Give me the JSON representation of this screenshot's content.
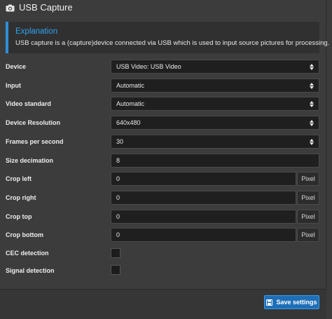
{
  "header": {
    "title": "USB Capture",
    "icon": "camera-icon"
  },
  "explanation": {
    "title": "Explanation",
    "text": "USB capture is a (capture)device connected via USB which is used to input source pictures for processing."
  },
  "fields": {
    "device": {
      "label": "Device",
      "value": "USB Video: USB Video"
    },
    "input": {
      "label": "Input",
      "value": "Automatic"
    },
    "video_standard": {
      "label": "Video standard",
      "value": "Automatic"
    },
    "device_resolution": {
      "label": "Device Resolution",
      "value": "640x480"
    },
    "fps": {
      "label": "Frames per second",
      "value": "30"
    },
    "size_decimation": {
      "label": "Size decimation",
      "value": "8"
    },
    "crop_left": {
      "label": "Crop left",
      "value": "0",
      "unit": "Pixel"
    },
    "crop_right": {
      "label": "Crop right",
      "value": "0",
      "unit": "Pixel"
    },
    "crop_top": {
      "label": "Crop top",
      "value": "0",
      "unit": "Pixel"
    },
    "crop_bottom": {
      "label": "Crop bottom",
      "value": "0",
      "unit": "Pixel"
    },
    "cec_detection": {
      "label": "CEC detection",
      "checked": false
    },
    "signal_detection": {
      "label": "Signal detection",
      "checked": false
    }
  },
  "footer": {
    "save_label": "Save settings",
    "save_icon": "save-icon"
  },
  "colors": {
    "accent": "#2ea3f2",
    "button": "#1e6fb8",
    "background": "#3c3c3c"
  }
}
